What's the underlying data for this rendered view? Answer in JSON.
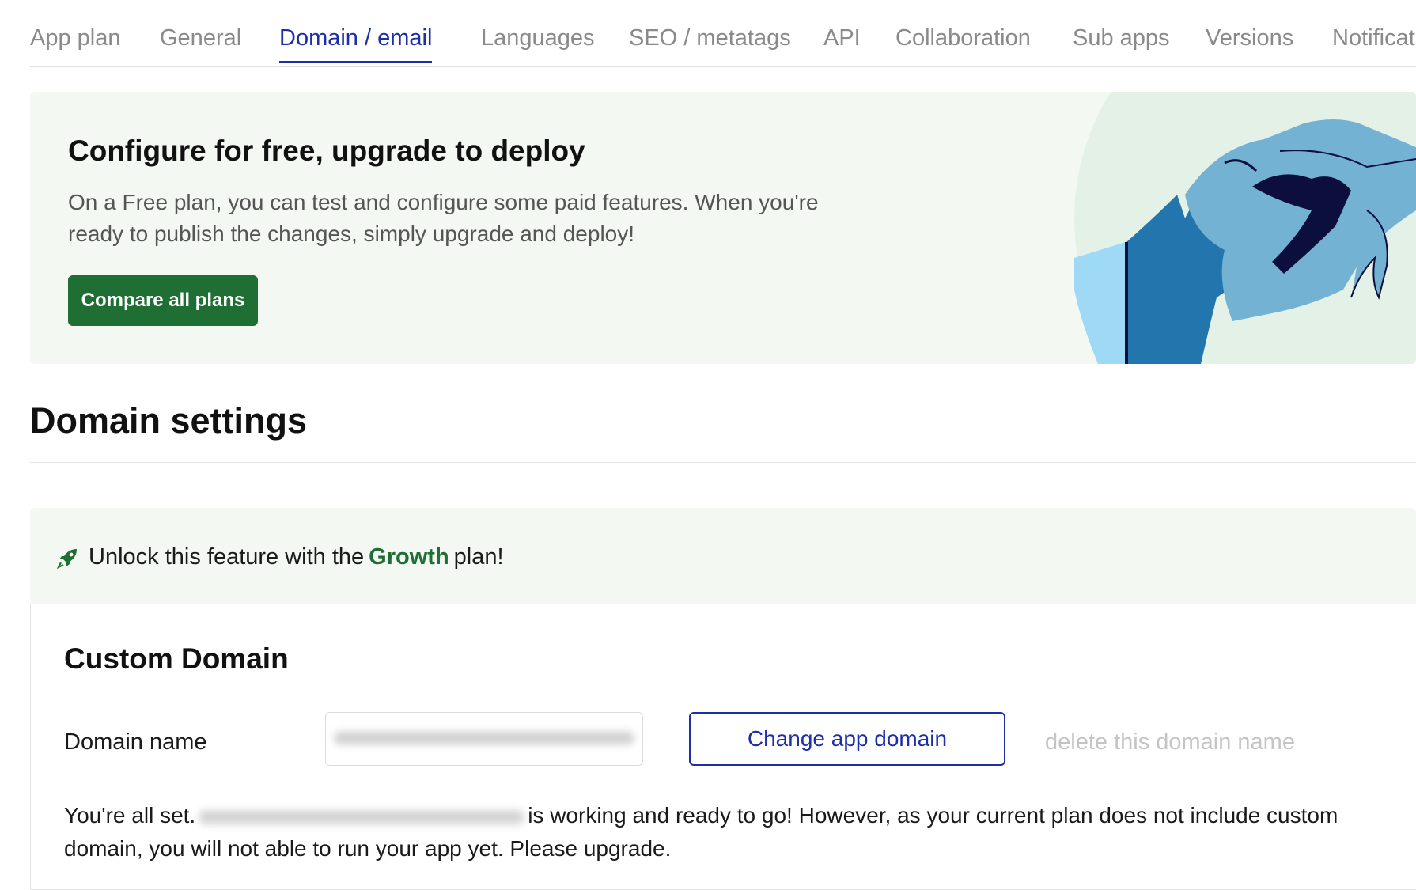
{
  "tabs": [
    {
      "label": "App plan"
    },
    {
      "label": "General"
    },
    {
      "label": "Domain / email"
    },
    {
      "label": "Languages"
    },
    {
      "label": "SEO / metatags"
    },
    {
      "label": "API"
    },
    {
      "label": "Collaboration"
    },
    {
      "label": "Sub apps"
    },
    {
      "label": "Versions"
    },
    {
      "label": "Notificat"
    }
  ],
  "promo": {
    "title": "Configure for free, upgrade to deploy",
    "text": "On a Free plan, you can test and configure some paid features. When you're ready to publish the changes, simply upgrade and deploy!",
    "button_label": "Compare all plans"
  },
  "domain_settings": {
    "title": "Domain settings",
    "unlock": {
      "prefix": "Unlock this feature with the",
      "plan": "Growth",
      "suffix": "plan!"
    },
    "custom_domain": {
      "title": "Custom Domain",
      "field_label": "Domain name",
      "change_button_label": "Change app domain",
      "delete_link_label": "delete this domain name",
      "status_prefix": "You're all set.",
      "status_suffix": "is working and ready to go! However, as your current plan does not include custom domain, you will not able to run your app yet. Please upgrade."
    }
  },
  "colors": {
    "accent_blue": "#1d2fa8",
    "brand_green": "#1f6e34",
    "panel_green": "#f3f8f3"
  },
  "icons": {
    "unlock": "rocket-icon",
    "promo_art": "hand-illustration"
  }
}
